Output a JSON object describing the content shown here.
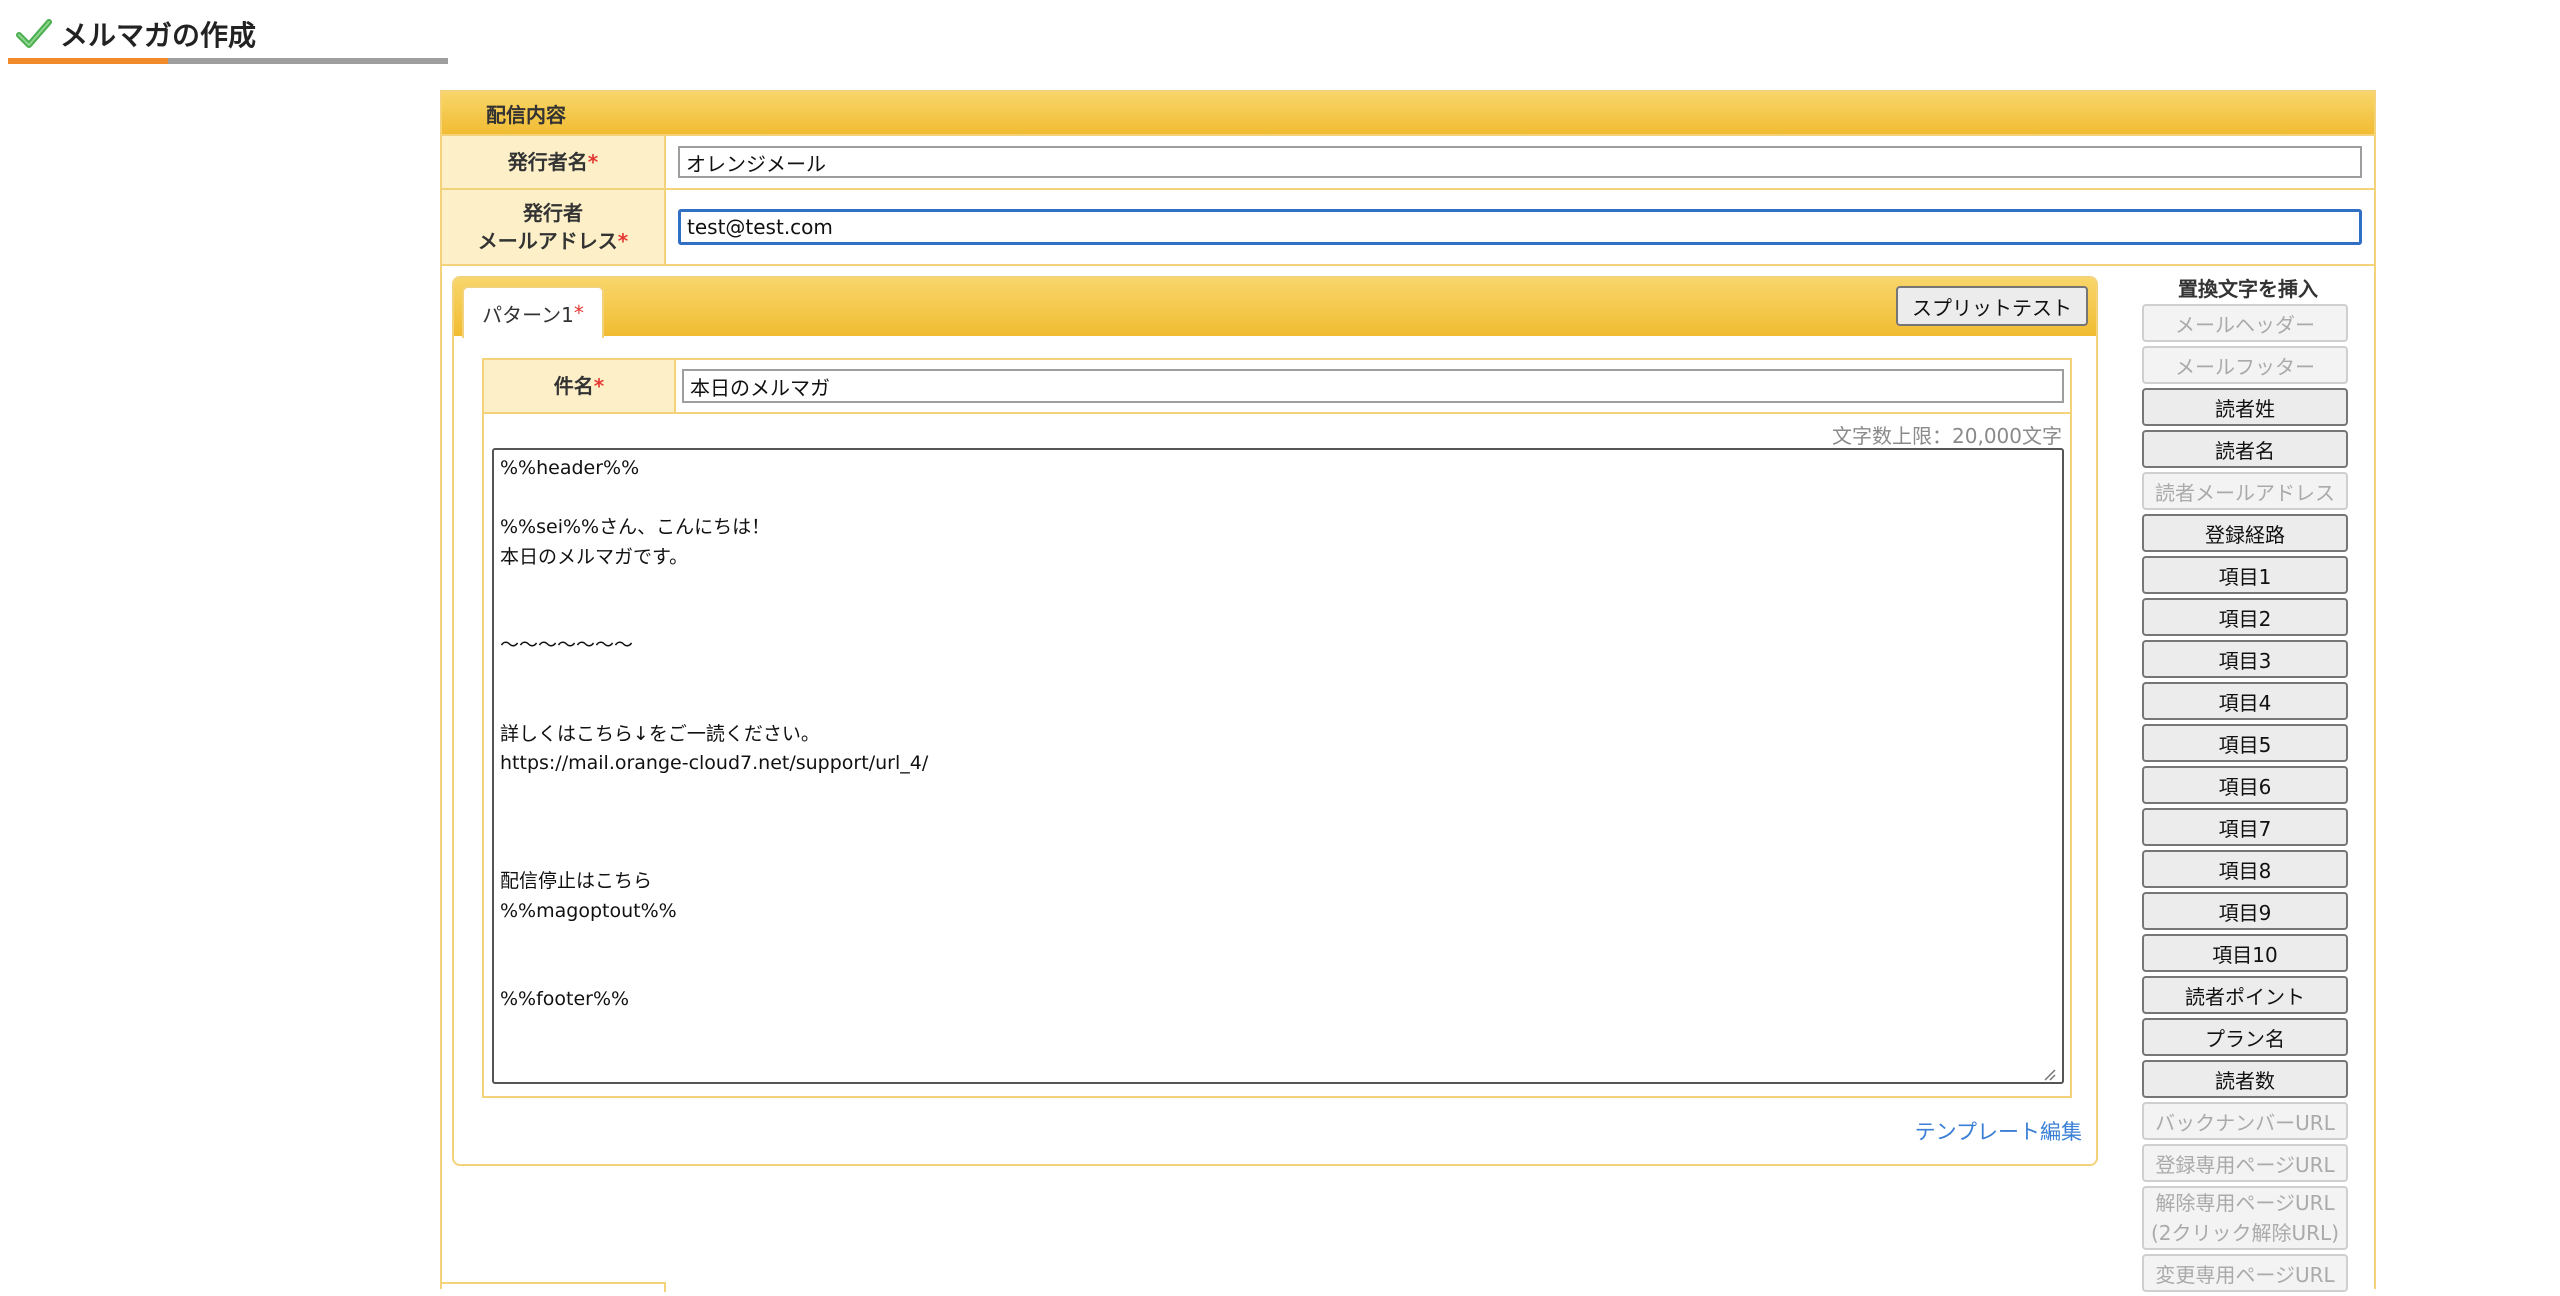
{
  "page": {
    "title": "メルマガの作成"
  },
  "section": {
    "title": "配信内容"
  },
  "fields": {
    "sender_name": {
      "label": "発行者名",
      "required_mark": "*",
      "value": "オレンジメール"
    },
    "sender_email": {
      "label_line1": "発行者",
      "label_line2": "メールアドレス",
      "required_mark": "*",
      "value": "test@test.com"
    }
  },
  "pattern": {
    "tab_label": "パターン1",
    "required_mark": "*",
    "split_test_label": "スプリットテスト",
    "subject": {
      "label": "件名",
      "required_mark": "*",
      "value": "本日のメルマガ"
    },
    "char_limit": "文字数上限：20,000文字",
    "body": "%%header%%\n\n%%sei%%さん、こんにちは！\n本日のメルマガです。\n\n\n〜〜〜〜〜〜〜\n\n\n詳しくはこちら↓をご一読ください。\nhttps://mail.orange-cloud7.net/support/url_4/\n\n\n\n配信停止はこちら\n%%magoptout%%\n\n\n%%footer%%",
    "template_edit_label": "テンプレート編集"
  },
  "placeholders": {
    "title": "置換文字を挿入",
    "buttons": [
      {
        "label": "メールヘッダー",
        "enabled": false
      },
      {
        "label": "メールフッター",
        "enabled": false
      },
      {
        "label": "読者姓",
        "enabled": true
      },
      {
        "label": "読者名",
        "enabled": true
      },
      {
        "label": "読者メールアドレス",
        "enabled": false
      },
      {
        "label": "登録経路",
        "enabled": true
      },
      {
        "label": "項目1",
        "enabled": true
      },
      {
        "label": "項目2",
        "enabled": true
      },
      {
        "label": "項目3",
        "enabled": true
      },
      {
        "label": "項目4",
        "enabled": true
      },
      {
        "label": "項目5",
        "enabled": true
      },
      {
        "label": "項目6",
        "enabled": true
      },
      {
        "label": "項目7",
        "enabled": true
      },
      {
        "label": "項目8",
        "enabled": true
      },
      {
        "label": "項目9",
        "enabled": true
      },
      {
        "label": "項目10",
        "enabled": true
      },
      {
        "label": "読者ポイント",
        "enabled": true
      },
      {
        "label": "プラン名",
        "enabled": true
      },
      {
        "label": "読者数",
        "enabled": true
      },
      {
        "label": "バックナンバーURL",
        "enabled": false
      },
      {
        "label": "登録専用ページURL",
        "enabled": false
      },
      {
        "label": "解除専用ページURL",
        "label_line2": "(2クリック解除URL)",
        "enabled": false
      },
      {
        "label": "変更専用ページURL",
        "enabled": false
      }
    ]
  },
  "colors": {
    "accent_orange": "#f08a2b",
    "header_gold": "#f1bc32",
    "label_bg": "#fdf0c8",
    "required_red": "#e53935",
    "link_blue": "#3a7fd5",
    "check_green": "#5cb85c"
  },
  "icons": {
    "title_icon": "check-icon"
  }
}
